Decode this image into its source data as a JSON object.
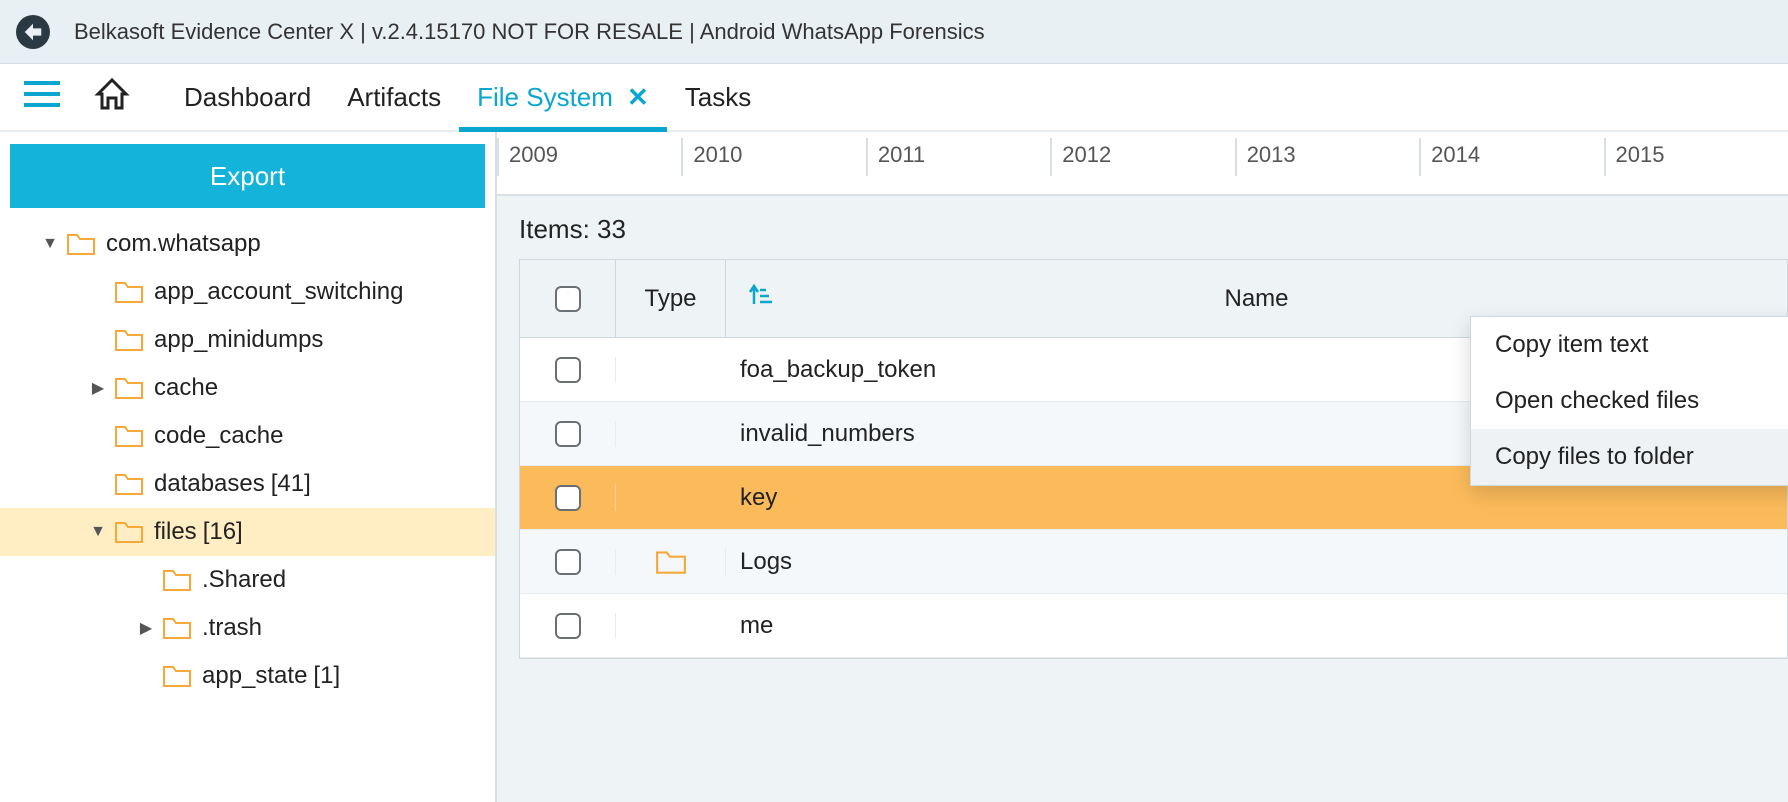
{
  "app_title": "Belkasoft Evidence Center X | v.2.4.15170 NOT FOR RESALE | Android WhatsApp Forensics",
  "tabs": {
    "dashboard": "Dashboard",
    "artifacts": "Artifacts",
    "filesystem": "File System",
    "tasks": "Tasks"
  },
  "export_label": "Export",
  "tree": [
    {
      "indent": 0,
      "disclosure": "down",
      "label": "com.whatsapp",
      "count": null,
      "selected": false
    },
    {
      "indent": 1,
      "disclosure": "",
      "label": "app_account_switching",
      "count": null,
      "selected": false
    },
    {
      "indent": 1,
      "disclosure": "",
      "label": "app_minidumps",
      "count": null,
      "selected": false
    },
    {
      "indent": 1,
      "disclosure": "right",
      "label": "cache",
      "count": null,
      "selected": false
    },
    {
      "indent": 1,
      "disclosure": "",
      "label": "code_cache",
      "count": null,
      "selected": false
    },
    {
      "indent": 1,
      "disclosure": "",
      "label": "databases",
      "count": "[41]",
      "selected": false
    },
    {
      "indent": 1,
      "disclosure": "down",
      "label": "files",
      "count": "[16]",
      "selected": true
    },
    {
      "indent": 2,
      "disclosure": "",
      "label": ".Shared",
      "count": null,
      "selected": false
    },
    {
      "indent": 2,
      "disclosure": "right",
      "label": ".trash",
      "count": null,
      "selected": false
    },
    {
      "indent": 2,
      "disclosure": "",
      "label": "app_state",
      "count": "[1]",
      "selected": false
    }
  ],
  "timeline_years": [
    "2009",
    "2010",
    "2011",
    "2012",
    "2013",
    "2014",
    "2015"
  ],
  "items_count_label": "Items: 33",
  "columns": {
    "type": "Type",
    "name": "Name"
  },
  "rows": [
    {
      "type": "",
      "name": "foa_backup_token",
      "selected": false
    },
    {
      "type": "",
      "name": "invalid_numbers",
      "selected": false
    },
    {
      "type": "",
      "name": "key",
      "selected": true
    },
    {
      "type": "folder",
      "name": "Logs",
      "selected": false
    },
    {
      "type": "",
      "name": "me",
      "selected": false
    }
  ],
  "context_menu": [
    {
      "label": "Copy item text",
      "hover": false
    },
    {
      "label": "Open checked files",
      "hover": false
    },
    {
      "label": "Copy files to folder",
      "hover": true
    }
  ]
}
